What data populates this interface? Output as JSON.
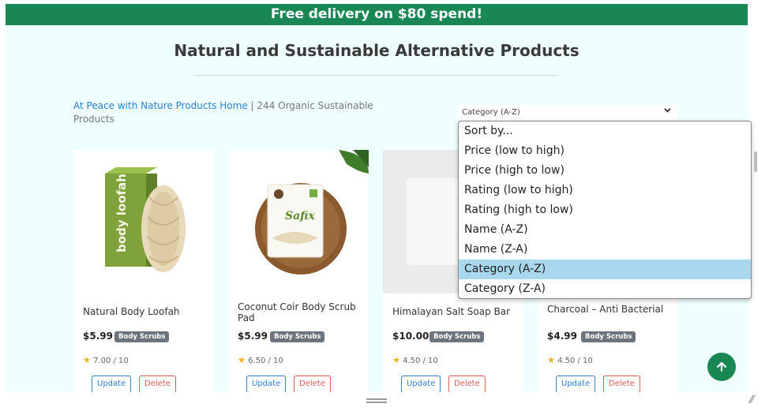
{
  "banner": {
    "text": "Free delivery on $80 spend!"
  },
  "page_title": "Natural and Sustainable Alternative Products",
  "breadcrumb": {
    "home_link": "At Peace with Nature Products Home",
    "separator": "|",
    "count_text": "244 Organic Sustainable Products"
  },
  "sort": {
    "selected_label": "Category (A-Z)",
    "options": [
      "Sort by...",
      "Price (low to high)",
      "Price (high to low)",
      "Rating (low to high)",
      "Rating (high to low)",
      "Name (A-Z)",
      "Name (Z-A)",
      "Category (A-Z)",
      "Category (Z-A)"
    ],
    "selected_index": 7
  },
  "products": [
    {
      "name": "Natural Body Loofah",
      "price": "$5.99",
      "category": "Body Scrubs",
      "rating": "7.00 / 10",
      "update_label": "Update",
      "delete_label": "Delete"
    },
    {
      "name": "Coconut Coir Body Scrub Pad",
      "price": "$5.99",
      "category": "Body Scrubs",
      "rating": "6.50 / 10",
      "update_label": "Update",
      "delete_label": "Delete",
      "image_text": "Safix"
    },
    {
      "name": "Himalayan Salt Soap Bar",
      "price": "$10.00",
      "category": "Body Scrubs",
      "rating": "4.50 / 10",
      "update_label": "Update",
      "delete_label": "Delete"
    },
    {
      "name": "Charcoal – Anti Bacterial",
      "price": "$4.99",
      "category": "Body Scrubs",
      "rating": "4.50 / 10",
      "update_label": "Update",
      "delete_label": "Delete"
    }
  ],
  "icons": {
    "star": "star-icon",
    "back_to_top": "arrow-up-icon",
    "chevron": "chevron-down-icon"
  },
  "colors": {
    "brand_green": "#198754",
    "page_bg": "#effefe",
    "link_blue": "#2c7fcf",
    "badge_grey": "#6c757d",
    "selected_option": "#a9d8ee"
  }
}
